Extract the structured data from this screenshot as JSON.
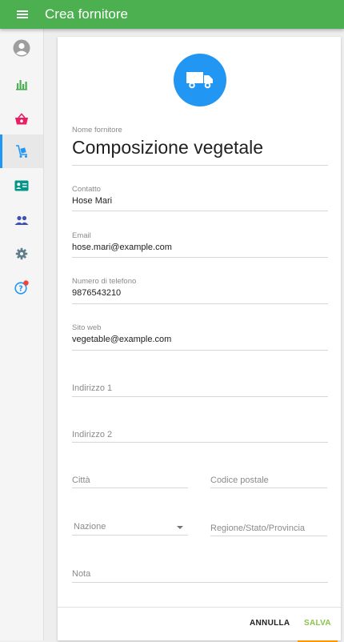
{
  "appbar": {
    "title": "Crea fornitore",
    "menu_icon": "menu-icon"
  },
  "sidebar": {
    "items": [
      {
        "name": "account",
        "icon": "account-icon",
        "color": "#9e9e9e"
      },
      {
        "name": "reports",
        "icon": "bar-chart-icon",
        "color": "#4caf50"
      },
      {
        "name": "sales",
        "icon": "basket-icon",
        "color": "#e91e63"
      },
      {
        "name": "suppliers",
        "icon": "cart-dolly-icon",
        "color": "#2196f3",
        "active": true
      },
      {
        "name": "customers",
        "icon": "contact-card-icon",
        "color": "#009688"
      },
      {
        "name": "employees",
        "icon": "people-icon",
        "color": "#3f51b5"
      },
      {
        "name": "settings",
        "icon": "gear-icon",
        "color": "#607d8b"
      },
      {
        "name": "help",
        "icon": "help-icon",
        "color": "#2196f3",
        "badge_color": "#f44336"
      }
    ]
  },
  "form": {
    "header_icon": "truck-icon",
    "supplier_name": {
      "label": "Nome fornitore",
      "value": "Composizione vegetale"
    },
    "contact": {
      "label": "Contatto",
      "value": "Hose Mari"
    },
    "email": {
      "label": "Email",
      "value": "hose.mari@example.com"
    },
    "phone": {
      "label": "Numero di telefono",
      "value": "9876543210"
    },
    "website": {
      "label": "Sito web",
      "value": "vegetable@example.com"
    },
    "address1": {
      "placeholder": "Indirizzo 1"
    },
    "address2": {
      "placeholder": "Indirizzo 2"
    },
    "city": {
      "placeholder": "Città"
    },
    "postal_code": {
      "placeholder": "Codice postale"
    },
    "country": {
      "placeholder": "Nazione"
    },
    "region": {
      "placeholder": "Regione/Stato/Provincia"
    },
    "note": {
      "placeholder": "Nota"
    }
  },
  "actions": {
    "cancel_label": "ANNULLA",
    "save_label": "SALVA"
  }
}
